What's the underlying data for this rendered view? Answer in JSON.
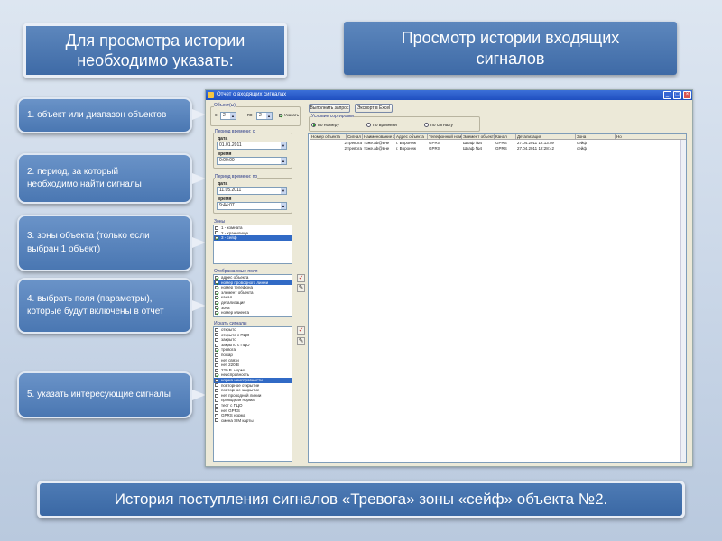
{
  "header_left": "Для просмотра истории\nнеобходимо указать:",
  "header_right": "Просмотр истории входящих\nсигналов",
  "callouts": [
    "1.  объект или диапазон объектов",
    "2. период, за который\nнеобходимо найти сигналы",
    "3. зоны объекта (только если\nвыбран 1 объект)",
    "4. выбрать поля (параметры),\nкоторые будут включены в отчет",
    "5. указать интересующие сигналы"
  ],
  "footer": "История поступления сигналов «Тревога» зоны «сейф» объекта №2.",
  "window": {
    "title": "Отчет о входящих сигналах",
    "objects_group": "Объект(ы)",
    "from_label": "с",
    "from_value": "2",
    "to_label": "по",
    "to_value": "2",
    "show_label": "Указать",
    "btn_query": "Выполнить запрос",
    "btn_export": "Экспорт в Excel",
    "sort_group": "Условие сортировки",
    "sort_options": [
      "по номеру",
      "по времени",
      "по сигналу"
    ],
    "period_from_group": "Период времени: с",
    "date_label": "дата",
    "time_label": "время",
    "date_from": "01.01.2011",
    "time_from": "0:00:00",
    "period_to_group": "Период времени: по",
    "date_to": "11.05.2011",
    "time_to": "9:44:07",
    "zones_group": "Зоны",
    "zones": [
      "1 - комната",
      "2 - хранилище",
      "3 - сейф"
    ],
    "fields_group": "Отображаемые поля",
    "fields": [
      "адрес объекта",
      "номер проводного линии",
      "номер телефона",
      "элемент объекта",
      "канал",
      "детализация",
      "зона",
      "номер клиента"
    ],
    "signals_group": "Искать сигналы",
    "signals": [
      "открыто",
      "открыто с ПЦО",
      "закрыто",
      "закрыто с ПЦО",
      "тревога",
      "пожар",
      "нет связи",
      "нет 220 В",
      "220 В. норма",
      "неисправность",
      "норма неисправности",
      "повторное открытие",
      "повторное закрытие",
      "нет проводной линии",
      "проводная норма",
      "тест с ПЦО",
      "нет GPRS",
      "GPRS норма",
      "смена SIM карты"
    ],
    "grid_headers": [
      "Номер объекта",
      "Сигнал",
      "Наименование объекта",
      "Адрес объекта",
      "Телефонный номер",
      "Элемент объекта",
      "Канал",
      "Детализация",
      "Зона",
      "Но"
    ],
    "grid_rows": [
      [
        "2",
        "тревога",
        "тоже.ab@вне",
        "г. Воронеж",
        "GPRS",
        "Шкаф №4",
        "GPRS",
        "27.04.2011 12:13:5е",
        "сейф"
      ],
      [
        "2",
        "тревога",
        "тоже.ab@вне",
        "г. Воронеж",
        "GPRS",
        "Шкаф №4",
        "GPRS",
        "27.04.2011 12:28:42",
        "сейф"
      ]
    ]
  }
}
